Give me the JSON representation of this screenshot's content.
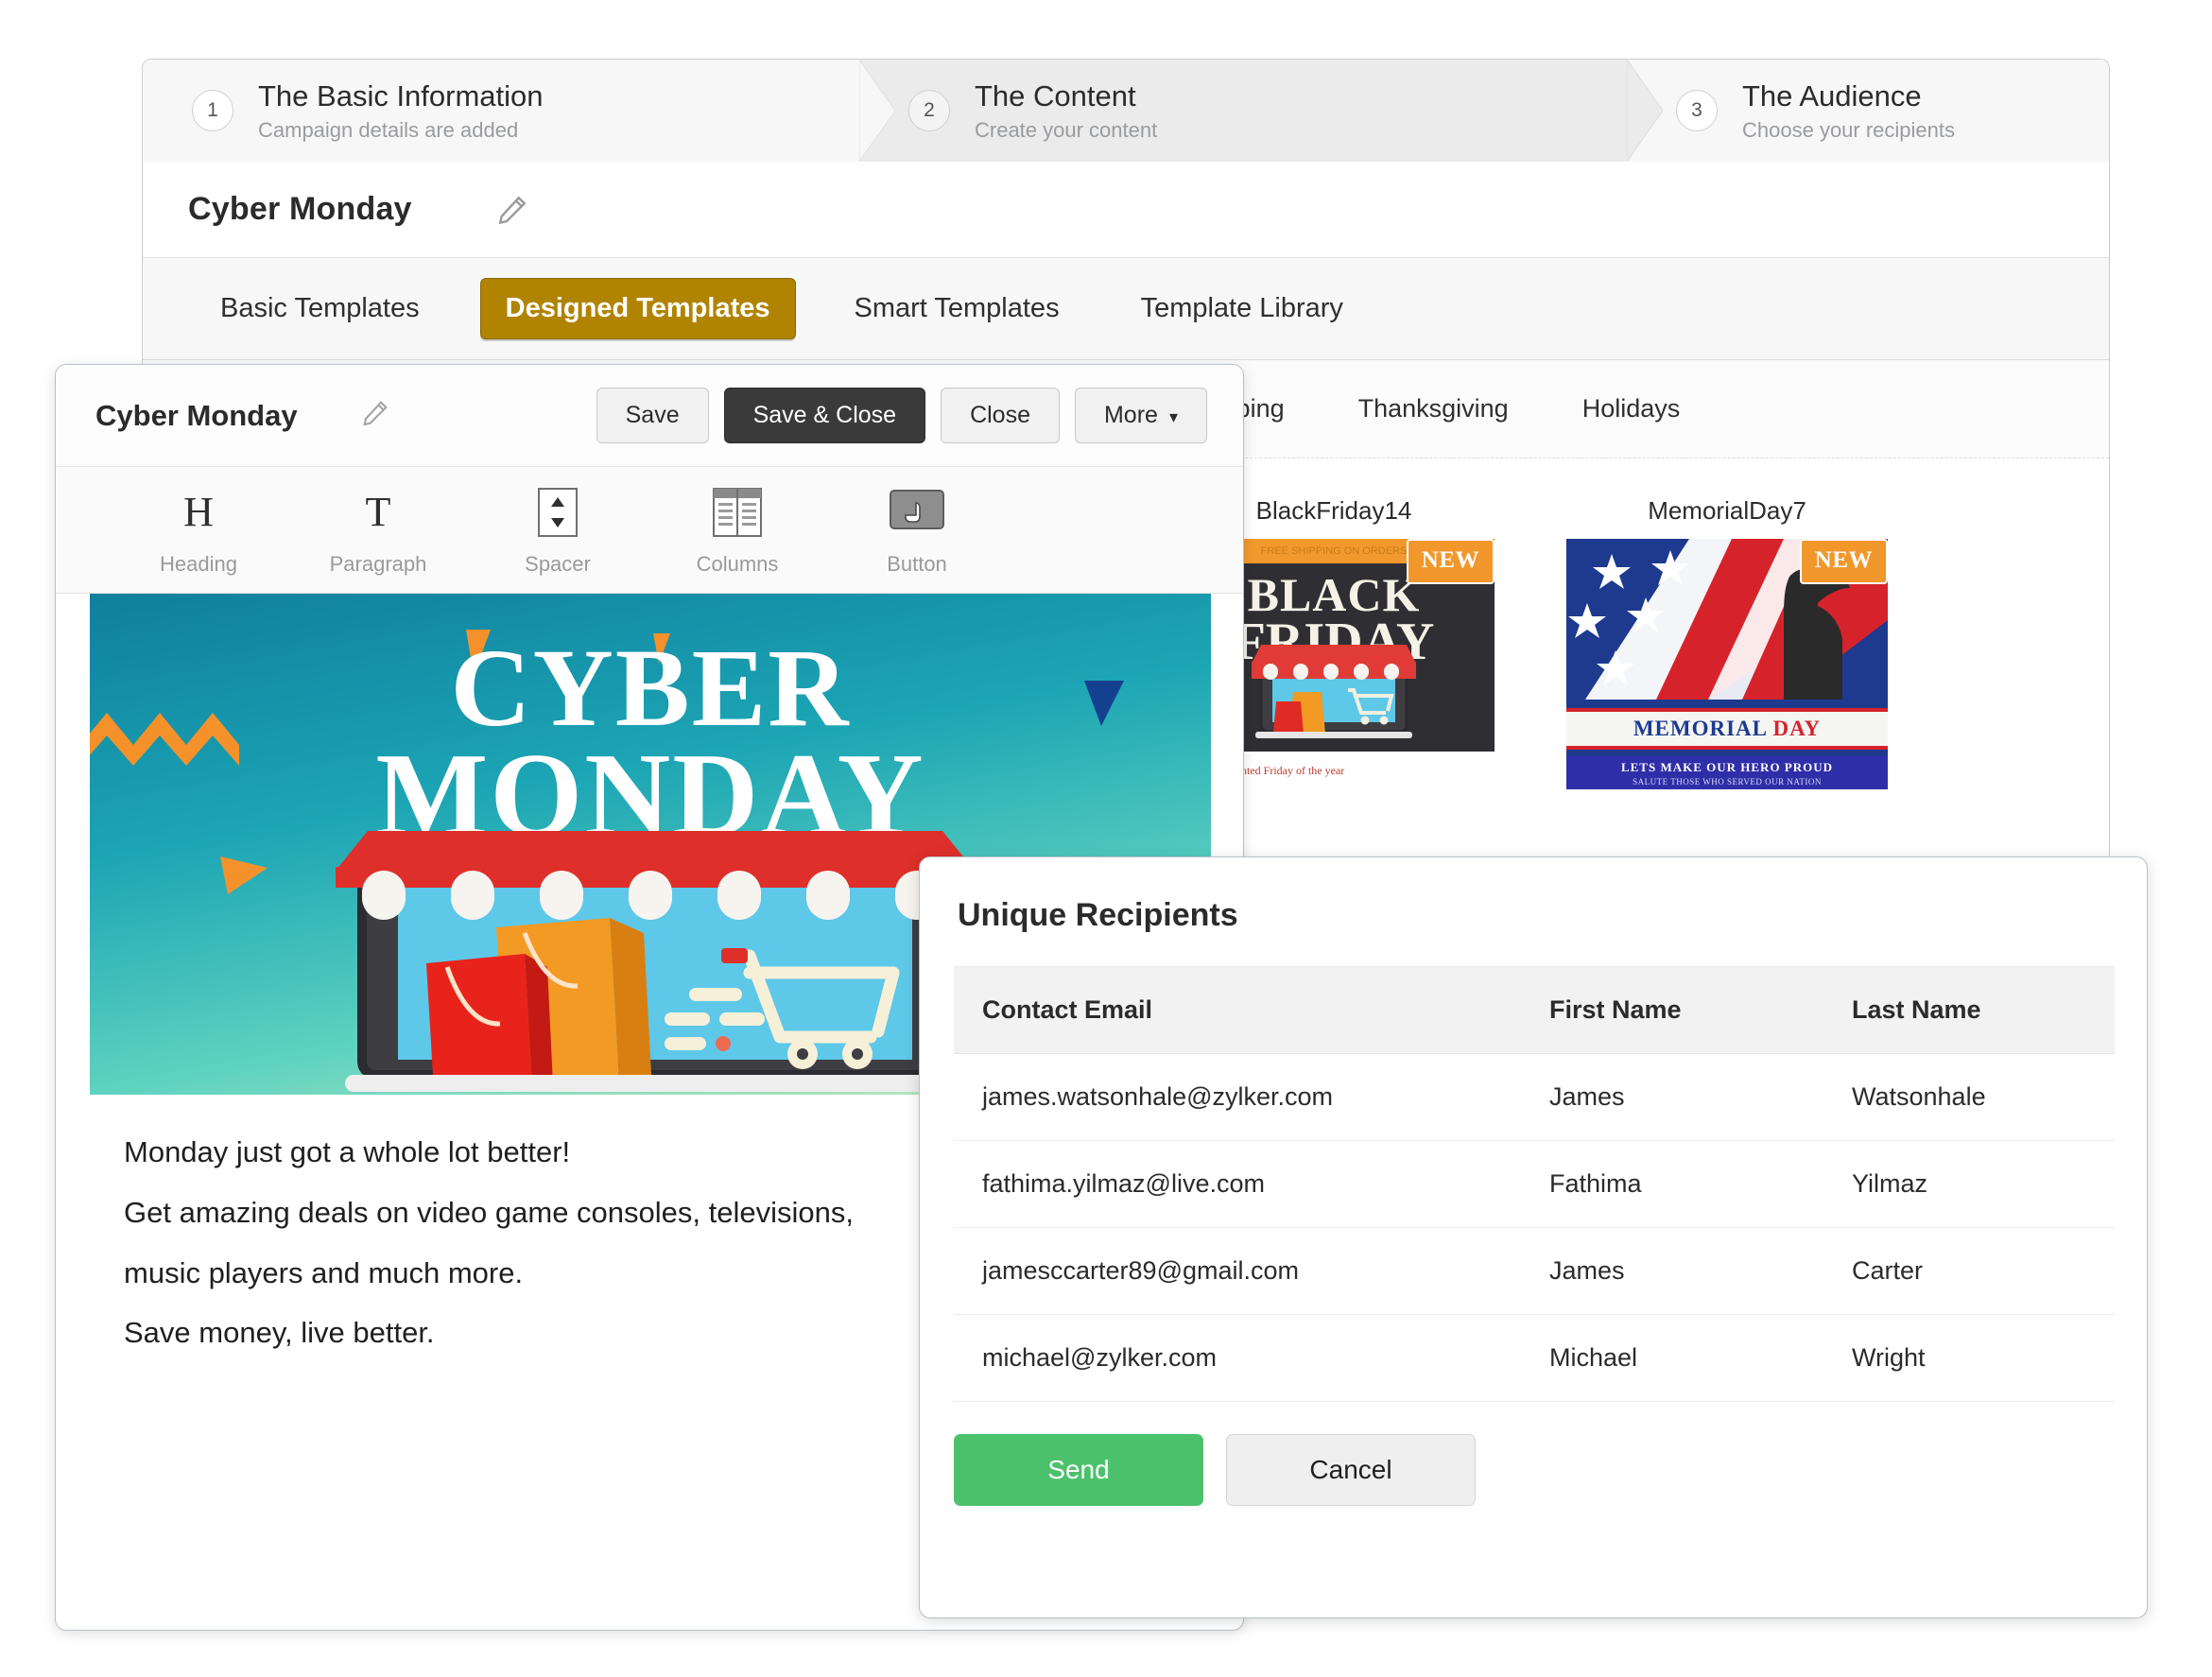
{
  "wizard": {
    "steps": [
      {
        "num": "1",
        "title": "The Basic Information",
        "sub": "Campaign details are added"
      },
      {
        "num": "2",
        "title": "The Content",
        "sub": "Create your content"
      },
      {
        "num": "3",
        "title": "The Audience",
        "sub": "Choose your recipients"
      }
    ]
  },
  "campaign": {
    "name": "Cyber Monday",
    "edit_icon": "pencil-icon"
  },
  "template_tabs": [
    {
      "label": "Basic Templates",
      "active": false
    },
    {
      "label": "Designed Templates",
      "active": true
    },
    {
      "label": "Smart Templates",
      "active": false
    },
    {
      "label": "Template Library",
      "active": false
    }
  ],
  "category_tabs": [
    {
      "label": "e Shipping"
    },
    {
      "label": "Thanksgiving"
    },
    {
      "label": "Holidays"
    }
  ],
  "templates": [
    {
      "name": "BlackFriday14",
      "badge": "NEW",
      "art": {
        "top_strip": "FREE SHIPPING ON ORDERS",
        "line1": "BLACK",
        "line2": "FRIDAY",
        "footer": "The most wanted Friday of the year"
      }
    },
    {
      "name": "MemorialDay7",
      "badge": "NEW",
      "art": {
        "title_a": "MEMORIAL",
        "title_b": "DAY",
        "line1": "LETS MAKE OUR HERO PROUD",
        "line2": "SALUTE THOSE WHO SERVED OUR NATION"
      }
    }
  ],
  "editor": {
    "title": "Cyber Monday",
    "edit_icon": "pencil-icon",
    "buttons": {
      "save": "Save",
      "save_close": "Save & Close",
      "close": "Close",
      "more": "More",
      "more_caret": "▾"
    },
    "toolbar": [
      {
        "label": "Heading",
        "icon": "heading-icon",
        "glyph": "H"
      },
      {
        "label": "Paragraph",
        "icon": "paragraph-icon",
        "glyph": "T"
      },
      {
        "label": "Spacer",
        "icon": "spacer-icon",
        "glyph": ""
      },
      {
        "label": "Columns",
        "icon": "columns-icon",
        "glyph": ""
      },
      {
        "label": "Button",
        "icon": "button-icon",
        "glyph": ""
      }
    ],
    "banner": {
      "line1": "CYBER",
      "line2": "MONDAY"
    },
    "body": [
      "Monday just got a whole lot better!",
      "Get amazing deals on video game consoles, televisions,",
      "music players and much more.",
      "Save money, live better."
    ]
  },
  "dialog": {
    "title": "Unique Recipients",
    "columns": [
      "Contact Email",
      "First Name",
      "Last Name"
    ],
    "rows": [
      {
        "email": "james.watsonhale@zylker.com",
        "first": "James",
        "last": "Watsonhale"
      },
      {
        "email": "fathima.yilmaz@live.com",
        "first": "Fathima",
        "last": "Yilmaz"
      },
      {
        "email": "jamesccarter89@gmail.com",
        "first": "James",
        "last": "Carter"
      },
      {
        "email": "michael@zylker.com",
        "first": "Michael",
        "last": "Wright"
      }
    ],
    "send_label": "Send",
    "cancel_label": "Cancel"
  },
  "colors": {
    "active_tab": "#b08400",
    "send_green": "#4cc16c",
    "badge_orange": "#f2972c",
    "dark_button": "#3a3a3a"
  }
}
